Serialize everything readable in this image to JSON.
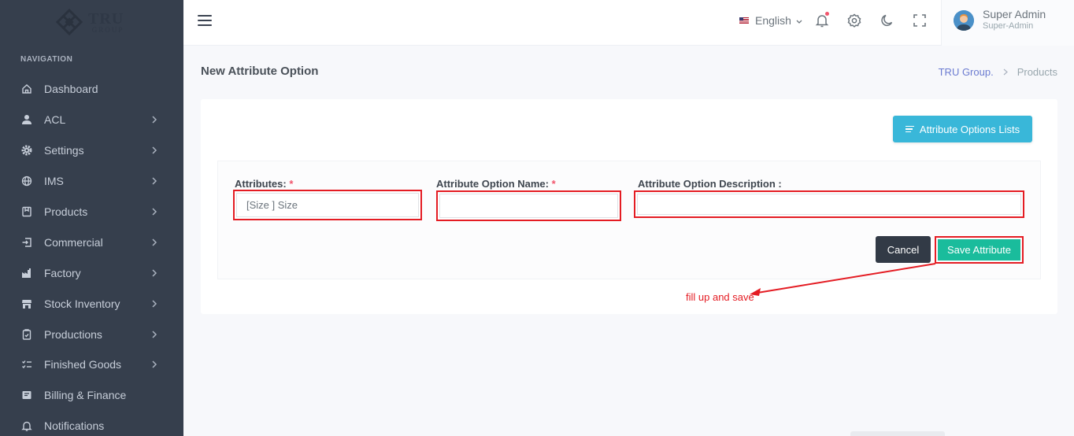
{
  "brand": {
    "name": "TRU",
    "sub": "GROUP"
  },
  "sidebar": {
    "section_label": "NAVIGATION",
    "items": [
      {
        "label": "Dashboard",
        "icon": "home-icon",
        "has_children": false
      },
      {
        "label": "ACL",
        "icon": "user-icon",
        "has_children": true
      },
      {
        "label": "Settings",
        "icon": "gear-icon",
        "has_children": true
      },
      {
        "label": "IMS",
        "icon": "globe-icon",
        "has_children": true
      },
      {
        "label": "Products",
        "icon": "bookmark-icon",
        "has_children": true
      },
      {
        "label": "Commercial",
        "icon": "login-icon",
        "has_children": true
      },
      {
        "label": "Factory",
        "icon": "factory-icon",
        "has_children": true
      },
      {
        "label": "Stock Inventory",
        "icon": "store-icon",
        "has_children": true
      },
      {
        "label": "Productions",
        "icon": "clipboard-icon",
        "has_children": true
      },
      {
        "label": "Finished Goods",
        "icon": "checklist-icon",
        "has_children": true
      },
      {
        "label": "Billing & Finance",
        "icon": "bill-icon",
        "has_children": false
      },
      {
        "label": "Notifications",
        "icon": "bell-icon",
        "has_children": false
      }
    ]
  },
  "topbar": {
    "language": "English",
    "user_name": "Super Admin",
    "user_role": "Super-Admin"
  },
  "page": {
    "title": "New Attribute Option",
    "breadcrumb": [
      "TRU Group.",
      "Products"
    ]
  },
  "form": {
    "list_button": "Attribute Options Lists",
    "attributes_label": "Attributes:",
    "attributes_value": "[Size ] Size",
    "option_name_label": "Attribute Option Name:",
    "option_name_value": "",
    "option_desc_label": "Attribute Option Description :",
    "option_desc_value": "",
    "required_mark": "*",
    "cancel_label": "Cancel",
    "save_label": "Save Attribute"
  },
  "annotation": {
    "text": "fill up and save",
    "color": "#e41c23"
  },
  "colors": {
    "sidebar_bg": "#363f4d",
    "save_bg": "#1abc9c",
    "list_btn_bg": "#39b7d9",
    "cancel_bg": "#323a46",
    "highlight": "#e41c23"
  }
}
